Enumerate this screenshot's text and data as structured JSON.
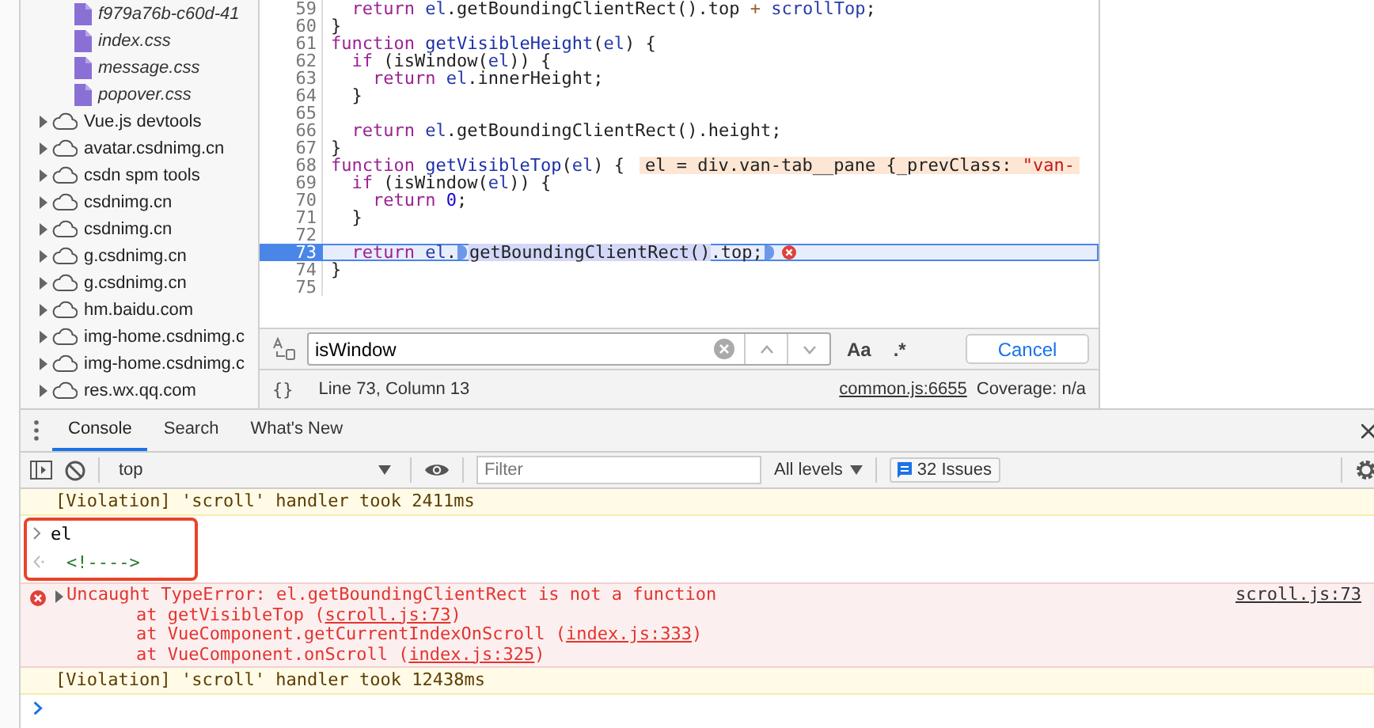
{
  "sidebar": {
    "items": [
      {
        "kind": "file",
        "label": "f979a76b-c60d-41"
      },
      {
        "kind": "file",
        "label": "index.css"
      },
      {
        "kind": "file",
        "label": "message.css"
      },
      {
        "kind": "file",
        "label": "popover.css"
      },
      {
        "kind": "domain",
        "label": "Vue.js devtools",
        "expanded": false
      },
      {
        "kind": "domain",
        "label": "avatar.csdnimg.cn",
        "expanded": false
      },
      {
        "kind": "domain",
        "label": "csdn spm tools",
        "expanded": false
      },
      {
        "kind": "domain",
        "label": "csdnimg.cn",
        "expanded": false
      },
      {
        "kind": "domain",
        "label": "csdnimg.cn",
        "expanded": false
      },
      {
        "kind": "domain",
        "label": "g.csdnimg.cn",
        "expanded": false
      },
      {
        "kind": "domain",
        "label": "g.csdnimg.cn",
        "expanded": false
      },
      {
        "kind": "domain",
        "label": "hm.baidu.com",
        "expanded": false
      },
      {
        "kind": "domain",
        "label": "img-home.csdnimg.c",
        "expanded": false
      },
      {
        "kind": "domain",
        "label": "img-home.csdnimg.c",
        "expanded": false
      },
      {
        "kind": "domain",
        "label": "res.wx.qq.com",
        "expanded": false
      }
    ]
  },
  "editor": {
    "lines": [
      {
        "number": "59",
        "current": false,
        "error": false,
        "tokens": [
          {
            "kind": "kw",
            "text": "  return"
          },
          {
            "kind": "var",
            "text": " el"
          },
          {
            "kind": "plain",
            "text": ".getBoundingClientRect().top "
          },
          {
            "kind": "op",
            "text": "+"
          },
          {
            "kind": "var",
            "text": " scrollTop"
          },
          {
            "kind": "plain",
            "text": ";"
          }
        ]
      },
      {
        "number": "60",
        "current": false,
        "error": false,
        "tokens": [
          {
            "kind": "plain",
            "text": "}"
          }
        ]
      },
      {
        "number": "61",
        "current": false,
        "error": false,
        "tokens": [
          {
            "kind": "kw",
            "text": "function"
          },
          {
            "kind": "def",
            "text": " getVisibleHeight"
          },
          {
            "kind": "plain",
            "text": "("
          },
          {
            "kind": "var",
            "text": "el"
          },
          {
            "kind": "plain",
            "text": ") {"
          }
        ]
      },
      {
        "number": "62",
        "current": false,
        "error": false,
        "tokens": [
          {
            "kind": "kw",
            "text": "  if"
          },
          {
            "kind": "plain",
            "text": " (isWindow("
          },
          {
            "kind": "var",
            "text": "el"
          },
          {
            "kind": "plain",
            "text": ")) {"
          }
        ]
      },
      {
        "number": "63",
        "current": false,
        "error": false,
        "tokens": [
          {
            "kind": "kw",
            "text": "    return"
          },
          {
            "kind": "var",
            "text": " el"
          },
          {
            "kind": "plain",
            "text": ".innerHeight;"
          }
        ]
      },
      {
        "number": "64",
        "current": false,
        "error": false,
        "tokens": [
          {
            "kind": "plain",
            "text": "  }"
          }
        ]
      },
      {
        "number": "65",
        "current": false,
        "error": false
      },
      {
        "number": "66",
        "current": false,
        "error": false,
        "tokens": [
          {
            "kind": "kw",
            "text": "  return"
          },
          {
            "kind": "var",
            "text": " el"
          },
          {
            "kind": "plain",
            "text": ".getBoundingClientRect().height;"
          }
        ]
      },
      {
        "number": "67",
        "current": false,
        "error": false,
        "tokens": [
          {
            "kind": "plain",
            "text": "}"
          }
        ]
      },
      {
        "number": "68",
        "current": false,
        "error": false,
        "tokens": [
          {
            "kind": "kw",
            "text": "function"
          },
          {
            "kind": "def",
            "text": " getVisibleTop"
          },
          {
            "kind": "plain",
            "text": "("
          },
          {
            "kind": "var",
            "text": "el"
          },
          {
            "kind": "plain",
            "text": ") {"
          }
        ],
        "inline_value": [
          {
            "kind": "plain",
            "text": "el = div.van-tab__pane {_prevClass: "
          },
          {
            "kind": "string",
            "text": "\"van-"
          }
        ]
      },
      {
        "number": "69",
        "current": false,
        "error": false,
        "tokens": [
          {
            "kind": "kw",
            "text": "  if"
          },
          {
            "kind": "plain",
            "text": " (isWindow("
          },
          {
            "kind": "var",
            "text": "el"
          },
          {
            "kind": "plain",
            "text": ")) {"
          }
        ]
      },
      {
        "number": "70",
        "current": false,
        "error": false,
        "tokens": [
          {
            "kind": "kw",
            "text": "    return"
          },
          {
            "kind": "num",
            "text": " 0"
          },
          {
            "kind": "plain",
            "text": ";"
          }
        ]
      },
      {
        "number": "71",
        "current": false,
        "error": false,
        "tokens": [
          {
            "kind": "plain",
            "text": "  }"
          }
        ]
      },
      {
        "number": "72",
        "current": false,
        "error": false
      },
      {
        "number": "73",
        "current": true,
        "error": true,
        "tokens": [
          {
            "kind": "kw",
            "text": "  return"
          },
          {
            "kind": "var",
            "text": " el"
          },
          {
            "kind": "plain",
            "text": "."
          },
          {
            "kind": "hl",
            "text": "getBoundingClientRect()"
          },
          {
            "kind": "plain",
            "text": ".top;"
          }
        ]
      },
      {
        "number": "74",
        "current": false,
        "error": false,
        "tokens": [
          {
            "kind": "plain",
            "text": "}"
          }
        ]
      },
      {
        "number": "75",
        "current": false,
        "error": false
      }
    ]
  },
  "search": {
    "value": "isWindow",
    "case_button": "Aa",
    "regex_button": ".*",
    "cancel_button": "Cancel"
  },
  "status": {
    "format_button": "{}",
    "position": "Line 73, Column 13",
    "source_link": "common.js:6655",
    "coverage": "Coverage: n/a"
  },
  "drawer": {
    "tabs": [
      {
        "label": "Console",
        "selected": true
      },
      {
        "label": "Search",
        "selected": false
      },
      {
        "label": "What's New",
        "selected": false
      }
    ]
  },
  "toolbar": {
    "context": "top",
    "filter_placeholder": "Filter",
    "levels": "All levels",
    "issues": "32 Issues"
  },
  "console": {
    "messages": [
      {
        "kind": "violation",
        "highlighted": false,
        "text": "[Violation] 'scroll' handler took 2411ms"
      },
      {
        "kind": "input",
        "highlighted": true,
        "text": "el"
      },
      {
        "kind": "result",
        "highlighted": true,
        "text": "<!---->"
      },
      {
        "kind": "error",
        "highlighted": false,
        "text": "Uncaught TypeError: el.getBoundingClientRect is not a function",
        "source": "scroll.js:73",
        "frames": [
          {
            "prefix": "at getVisibleTop (",
            "link": "scroll.js:73",
            "suffix": ")"
          },
          {
            "prefix": "at VueComponent.getCurrentIndexOnScroll (",
            "link": "index.js:333",
            "suffix": ")"
          },
          {
            "prefix": "at VueComponent.onScroll (",
            "link": "index.js:325",
            "suffix": ")"
          }
        ]
      },
      {
        "kind": "violation",
        "highlighted": false,
        "text": "[Violation] 'scroll' handler took 12438ms"
      },
      {
        "kind": "prompt",
        "highlighted": false
      }
    ]
  }
}
